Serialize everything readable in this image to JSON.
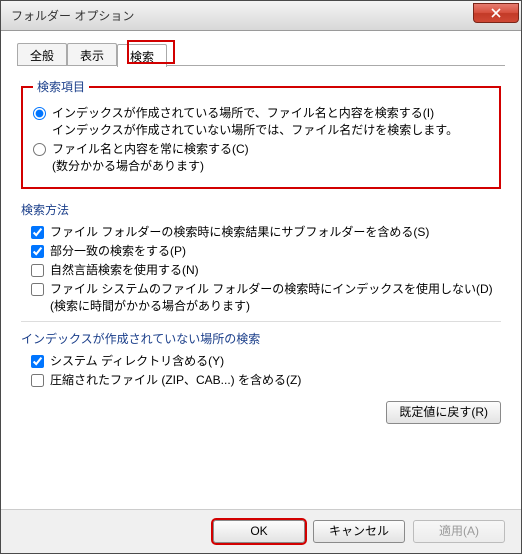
{
  "window": {
    "title": "フォルダー オプション"
  },
  "tabs": {
    "general": "全般",
    "view": "表示",
    "search": "検索"
  },
  "groups": {
    "what": {
      "legend": "検索項目",
      "opt1_line1": "インデックスが作成されている場所で、ファイル名と内容を検索する(I)",
      "opt1_line2": "インデックスが作成されていない場所では、ファイル名だけを検索します。",
      "opt2_line1": "ファイル名と内容を常に検索する(C)",
      "opt2_line2": "(数分かかる場合があります)"
    },
    "how": {
      "legend": "検索方法",
      "c1": "ファイル フォルダーの検索時に検索結果にサブフォルダーを含める(S)",
      "c2": "部分一致の検索をする(P)",
      "c3": "自然言語検索を使用する(N)",
      "c4_line1": "ファイル システムのファイル フォルダーの検索時にインデックスを使用しない(D)",
      "c4_line2": "(検索に時間がかかる場合があります)"
    },
    "nonindexed": {
      "legend": "インデックスが作成されていない場所の検索",
      "c1": "システム ディレクトリ含める(Y)",
      "c2": "圧縮されたファイル (ZIP、CAB...) を含める(Z)"
    }
  },
  "buttons": {
    "restore": "既定値に戻す(R)",
    "ok": "OK",
    "cancel": "キャンセル",
    "apply": "適用(A)"
  }
}
